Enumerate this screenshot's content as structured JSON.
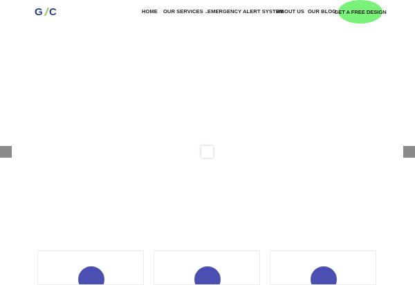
{
  "brand": {
    "logo_text": "G/C",
    "colors": {
      "primary": "#2a3a93",
      "accent": "#8cc63f"
    }
  },
  "nav": {
    "items": [
      {
        "label": "HOME"
      },
      {
        "label": "OUR SERVICES",
        "has_dropdown": true,
        "icon": "chevron-down-icon"
      },
      {
        "label": "EMERGENCY ALERT SYSTEM"
      },
      {
        "label": "ABOUT US"
      },
      {
        "label": "OUR BLOG"
      }
    ],
    "cta": {
      "label": "GET A FREE DESIGN",
      "color": "#7af27a"
    }
  },
  "slider": {
    "prev_icon": "prev-arrow-icon",
    "next_icon": "next-arrow-icon",
    "loader_icon": "loading-spinner-icon",
    "arrow_color": "#8a8a8a"
  },
  "features": {
    "circle_color": "#4b4fb2",
    "cards": [
      {
        "icon": "feature-circle-icon"
      },
      {
        "icon": "feature-circle-icon"
      },
      {
        "icon": "feature-circle-icon"
      }
    ]
  }
}
